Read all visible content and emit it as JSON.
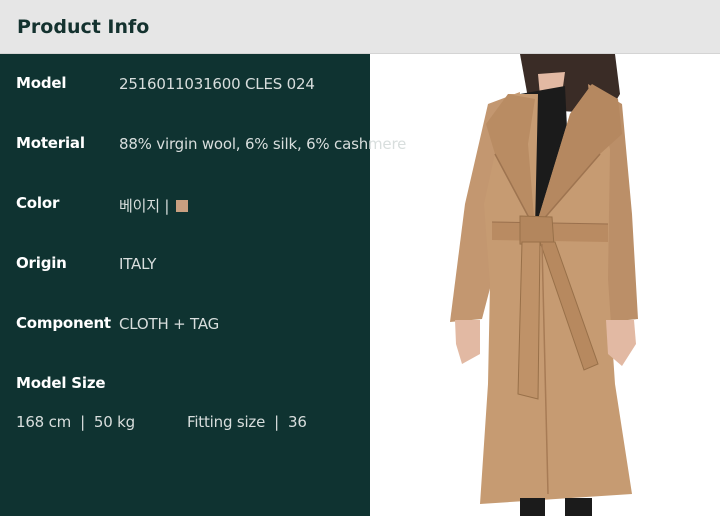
{
  "header": {
    "title": "Product Info"
  },
  "info": {
    "model": {
      "label": "Model",
      "value": "2516011031600 CLES 024"
    },
    "material": {
      "label": "Moterial",
      "value": "88% virgin wool, 6% silk, 6% cashmere"
    },
    "color": {
      "label": "Color",
      "value": "베이지 |",
      "swatch": "#c9a081"
    },
    "origin": {
      "label": "Origin",
      "value": "ITALY"
    },
    "component": {
      "label": "Component",
      "value": "CLOTH + TAG"
    }
  },
  "model_size": {
    "label": "Model Size",
    "height": "168 cm",
    "sep1": "|",
    "weight": "50 kg",
    "fitting_label": "Fitting size",
    "sep2": "|",
    "fitting_value": "36"
  },
  "colors": {
    "panel": "#0f3331",
    "header_bg": "#e6e6e6",
    "header_text": "#14322f",
    "coat": "#c69b72"
  }
}
